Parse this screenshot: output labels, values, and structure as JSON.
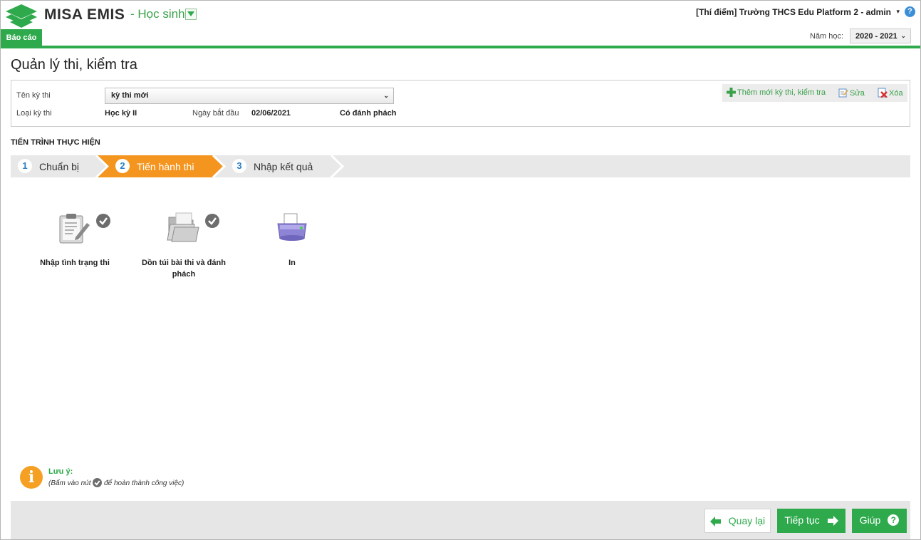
{
  "header": {
    "brand": "MISA EMIS",
    "module": "- Học sinh",
    "school_user": "[Thí điểm] Trường THCS Edu Platform 2 - admin",
    "caret": "▾",
    "help_glyph": "?",
    "report_tab": "Báo cáo",
    "year_label": "Năm học:",
    "year_value": "2020 - 2021"
  },
  "page": {
    "title": "Quản lý thi, kiểm tra"
  },
  "exam": {
    "name_label": "Tên kỳ thi",
    "name_value": "kỳ thi mới",
    "type_label": "Loại kỳ thi",
    "type_value": "Học kỳ II",
    "start_label": "Ngày bắt đầu",
    "start_value": "02/06/2021",
    "anonymize_value": "Có đánh phách"
  },
  "toolbar": {
    "add_label": "Thêm mới kỳ thi, kiểm tra",
    "edit_label": "Sửa",
    "delete_label": "Xóa"
  },
  "progress": {
    "section_label": "TIẾN TRÌNH THỰC HIỆN",
    "steps": [
      {
        "num": "1",
        "label": "Chuẩn bị"
      },
      {
        "num": "2",
        "label": "Tiến hành thi",
        "active": true
      },
      {
        "num": "3",
        "label": "Nhập kết quả"
      }
    ]
  },
  "tasks": [
    {
      "label": "Nhập tình trạng thi",
      "icon": "clipboard-pencil-icon",
      "done": true
    },
    {
      "label": "Dồn túi bài thi và đánh phách",
      "icon": "folders-icon",
      "done": true
    },
    {
      "label": "In",
      "icon": "printer-icon",
      "done": false
    }
  ],
  "note": {
    "title": "Lưu ý:",
    "text_before": "(Bấm vào nút",
    "text_after": "để hoàn thành công việc)",
    "info_glyph": "i"
  },
  "footer": {
    "back_label": "Quay lại",
    "next_label": "Tiếp tục",
    "help_label": "Giúp",
    "help_glyph": "?"
  },
  "colors": {
    "accent_green": "#2eaa4c",
    "step_active_orange": "#f4951f",
    "info_orange": "#f5a023"
  }
}
